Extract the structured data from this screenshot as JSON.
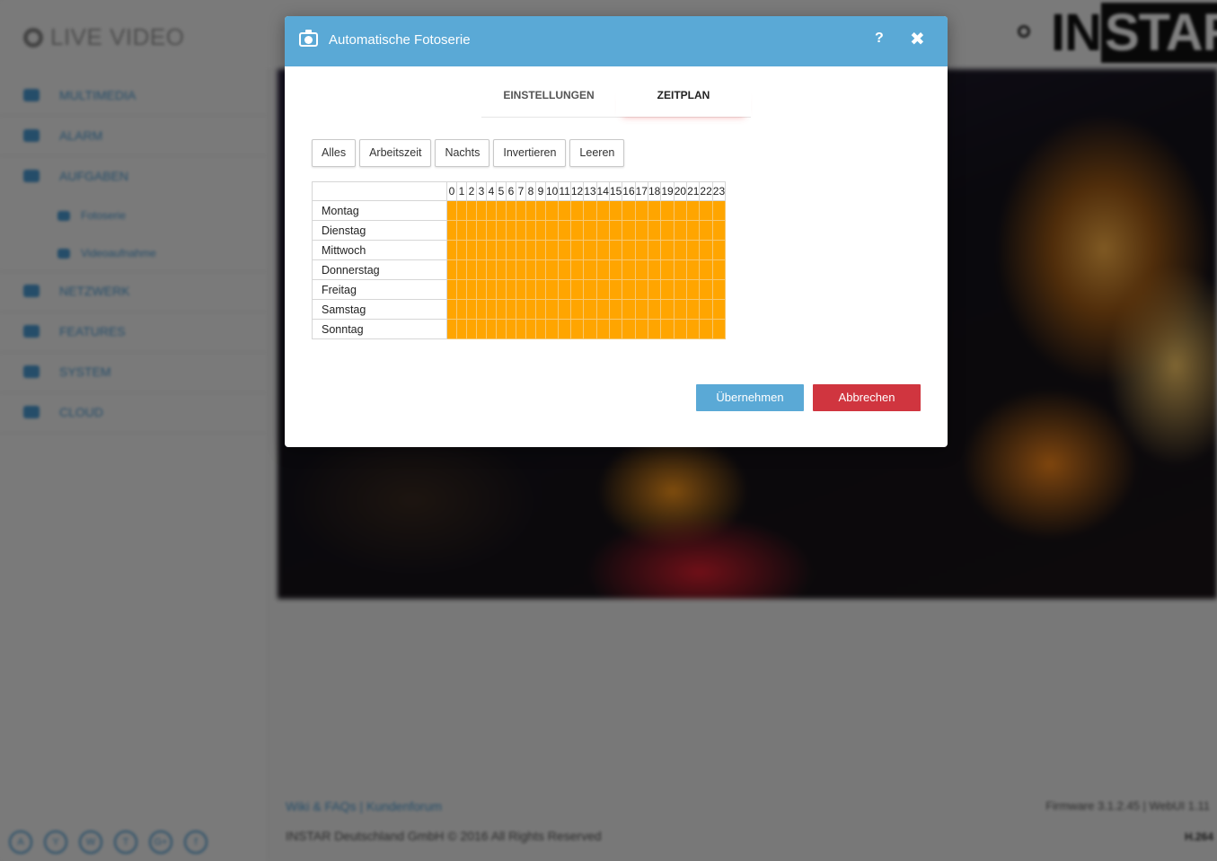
{
  "background": {
    "brand": "LIVE VIDEO",
    "sidebar": [
      {
        "label": "MULTIMEDIA",
        "icon": "image-icon"
      },
      {
        "label": "ALARM",
        "icon": "bell-icon"
      },
      {
        "label": "AUFGABEN",
        "icon": "film-icon"
      },
      {
        "label": "Fotoserie",
        "icon": "camera-icon",
        "sub": true
      },
      {
        "label": "Videoaufnahme",
        "icon": "video-icon",
        "sub": true
      },
      {
        "label": "NETZWERK",
        "icon": "network-icon"
      },
      {
        "label": "FEATURES",
        "icon": "star-icon"
      },
      {
        "label": "SYSTEM",
        "icon": "gear-icon"
      },
      {
        "label": "CLOUD",
        "icon": "cloud-icon"
      }
    ],
    "social": [
      "A",
      "Y",
      "W",
      "T",
      "G+",
      "f"
    ],
    "logo_in": "IN",
    "logo_star": "STAR",
    "footer_links": "Wiki & FAQs | Kundenforum",
    "footer_copy": "INSTAR Deutschland GmbH © 2016 All Rights Reserved",
    "footer_firmware": "Firmware 3.1.2.45 | WebUI 1.11",
    "footer_codec": "H.264"
  },
  "modal": {
    "title": "Automatische Fotoserie",
    "help": "?",
    "close": "✖",
    "tabs": [
      "EINSTELLUNGEN",
      "ZEITPLAN"
    ],
    "active_tab": "ZEITPLAN",
    "presets": [
      "Alles",
      "Arbeitszeit",
      "Nachts",
      "Invertieren",
      "Leeren"
    ],
    "schedule": {
      "hours": [
        "0",
        "1",
        "2",
        "3",
        "4",
        "5",
        "6",
        "7",
        "8",
        "9",
        "10",
        "11",
        "12",
        "13",
        "14",
        "15",
        "16",
        "17",
        "18",
        "19",
        "20",
        "21",
        "22",
        "23"
      ],
      "days": [
        "Montag",
        "Dienstag",
        "Mittwoch",
        "Donnerstag",
        "Freitag",
        "Samstag",
        "Sonntag"
      ],
      "active_color": "#ffa500",
      "all_active": true
    },
    "apply_label": "Übernehmen",
    "cancel_label": "Abbrechen"
  }
}
